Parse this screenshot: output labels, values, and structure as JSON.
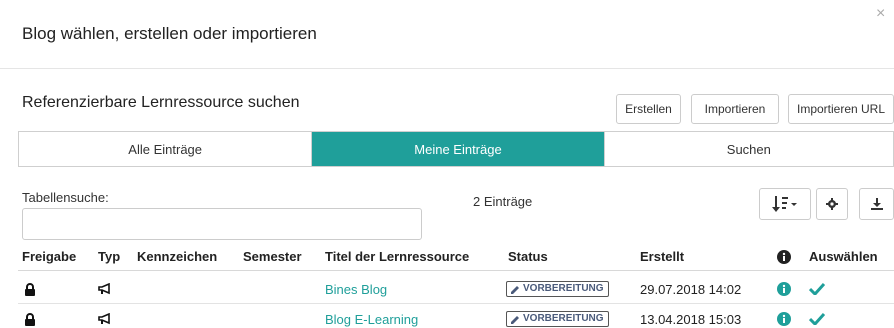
{
  "modal": {
    "title": "Blog wählen, erstellen oder importieren",
    "close_glyph": "×"
  },
  "section": {
    "title": "Referenzierbare Lernressource suchen"
  },
  "actions": {
    "create": "Erstellen",
    "import": "Importieren",
    "import_url": "Importieren URL"
  },
  "tabs": [
    {
      "label": "Alle Einträge",
      "active": false
    },
    {
      "label": "Meine Einträge",
      "active": true
    },
    {
      "label": "Suchen",
      "active": false
    }
  ],
  "search": {
    "label": "Tabellensuche:",
    "value": "",
    "placeholder": ""
  },
  "result_count": "2 Einträge",
  "columns": [
    "Freigabe",
    "Typ",
    "Kennzeichen",
    "Semester",
    "Titel der Lernressource",
    "Status",
    "Erstellt",
    "Auswählen"
  ],
  "rows": [
    {
      "title": "Bines Blog",
      "status": "VORBEREITUNG",
      "created": "29.07.2018 14:02"
    },
    {
      "title": "Blog E-Learning",
      "status": "VORBEREITUNG",
      "created": "13.04.2018 15:03"
    }
  ],
  "colors": {
    "accent": "#1f9f9a"
  },
  "icons": {
    "lock": "lock-icon",
    "type": "megaphone-icon",
    "info": "info-icon",
    "select": "check-icon",
    "status": "pencil-icon"
  }
}
